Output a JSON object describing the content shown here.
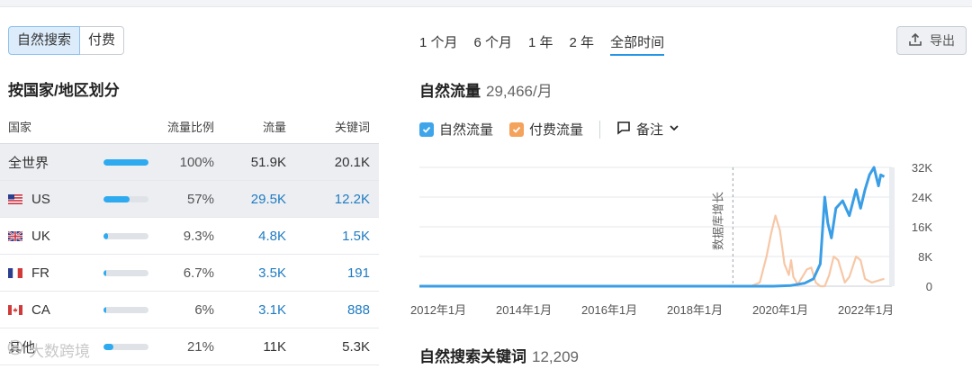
{
  "tabs": {
    "organic": "自然搜索",
    "paid": "付费"
  },
  "section_title": "按国家/地区划分",
  "table": {
    "headers": {
      "country": "国家",
      "share": "流量比例",
      "traffic": "流量",
      "keywords": "关键词"
    },
    "rows": [
      {
        "country": "全世界",
        "share": "100%",
        "share_value": 100,
        "traffic": "51.9K",
        "keywords": "20.1K",
        "flag": ""
      },
      {
        "country": "US",
        "share": "57%",
        "share_value": 57,
        "traffic": "29.5K",
        "keywords": "12.2K",
        "flag": "us-flag-icon"
      },
      {
        "country": "UK",
        "share": "9.3%",
        "share_value": 9.3,
        "traffic": "4.8K",
        "keywords": "1.5K",
        "flag": "uk-flag-icon"
      },
      {
        "country": "FR",
        "share": "6.7%",
        "share_value": 6.7,
        "traffic": "3.5K",
        "keywords": "191",
        "flag": "fr-flag-icon"
      },
      {
        "country": "CA",
        "share": "6%",
        "share_value": 6,
        "traffic": "3.1K",
        "keywords": "888",
        "flag": "ca-flag-icon"
      },
      {
        "country": "其他",
        "share": "21%",
        "share_value": 21,
        "traffic": "11K",
        "keywords": "5.3K",
        "flag": ""
      }
    ]
  },
  "periods": [
    "1 个月",
    "6 个月",
    "1 年",
    "2 年",
    "全部时间"
  ],
  "active_period": "全部时间",
  "export_label": "导出",
  "organic_traffic": {
    "label": "自然流量",
    "value": "29,466/月"
  },
  "legend": {
    "organic": "自然流量",
    "paid": "付费流量",
    "notes": "备注"
  },
  "chart_data": {
    "type": "line",
    "x_labels": [
      "2012年1月",
      "2014年1月",
      "2016年1月",
      "2018年1月",
      "2020年1月",
      "2022年1月"
    ],
    "y_ticks": [
      "32K",
      "24K",
      "16K",
      "8K",
      "0"
    ],
    "ylim": [
      0,
      32000
    ],
    "annotation": "数据库增长",
    "series": [
      {
        "name": "自然流量",
        "color": "#3a9ee6",
        "points": [
          [
            2012.0,
            0
          ],
          [
            2019.0,
            0
          ],
          [
            2019.9,
            0
          ],
          [
            2020.3,
            200
          ],
          [
            2020.6,
            800
          ],
          [
            2020.8,
            2000
          ],
          [
            2020.95,
            6000
          ],
          [
            2021.05,
            24000
          ],
          [
            2021.12,
            17000
          ],
          [
            2021.2,
            13000
          ],
          [
            2021.3,
            21000
          ],
          [
            2021.45,
            23000
          ],
          [
            2021.6,
            19000
          ],
          [
            2021.75,
            26000
          ],
          [
            2021.85,
            21000
          ],
          [
            2021.95,
            26000
          ],
          [
            2022.05,
            30000
          ],
          [
            2022.15,
            32000
          ],
          [
            2022.25,
            27000
          ],
          [
            2022.3,
            30000
          ],
          [
            2022.38,
            29500
          ]
        ]
      },
      {
        "name": "付费流量",
        "color": "#f7c7a6",
        "points": [
          [
            2012.0,
            0
          ],
          [
            2019.4,
            0
          ],
          [
            2019.6,
            1000
          ],
          [
            2019.75,
            8000
          ],
          [
            2019.85,
            14000
          ],
          [
            2019.95,
            19000
          ],
          [
            2020.05,
            15000
          ],
          [
            2020.15,
            6000
          ],
          [
            2020.25,
            3000
          ],
          [
            2020.3,
            7000
          ],
          [
            2020.35,
            2500
          ],
          [
            2020.45,
            500
          ],
          [
            2020.55,
            2500
          ],
          [
            2020.65,
            4500
          ],
          [
            2020.75,
            5000
          ],
          [
            2020.85,
            1000
          ],
          [
            2020.95,
            0
          ],
          [
            2021.05,
            0
          ],
          [
            2021.15,
            3000
          ],
          [
            2021.25,
            8000
          ],
          [
            2021.35,
            7000
          ],
          [
            2021.5,
            1000
          ],
          [
            2021.6,
            2500
          ],
          [
            2021.75,
            8000
          ],
          [
            2021.85,
            7000
          ],
          [
            2021.95,
            2000
          ],
          [
            2022.1,
            1000
          ],
          [
            2022.38,
            2000
          ]
        ]
      }
    ]
  },
  "keywords_title": {
    "label": "自然搜索关键词",
    "value": "12,209"
  },
  "watermark": "大数跨境"
}
